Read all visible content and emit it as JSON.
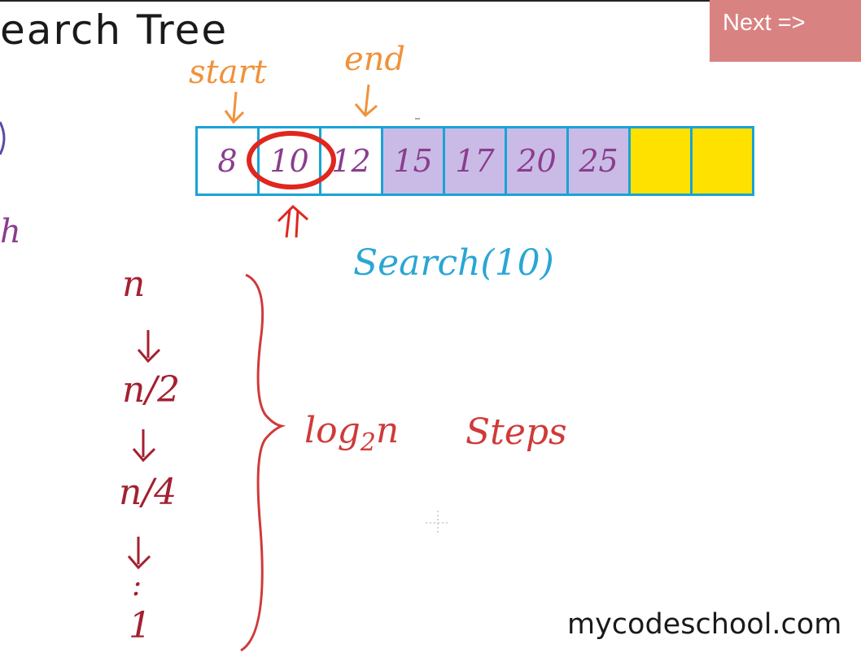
{
  "slide": {
    "title": "earch Tree",
    "start_label": "start",
    "end_label": "end",
    "partial_left_text": "h",
    "search_call": "Search(10)",
    "steps_sequence": [
      "n",
      "n/2",
      "n/4",
      ":",
      "1"
    ],
    "complexity_prefix": "log",
    "complexity_subscript": "2",
    "complexity_var": "n",
    "complexity_suffix": "Steps",
    "array_cells": [
      {
        "value": "8",
        "fill": "#ffffff"
      },
      {
        "value": "10",
        "fill": "#ffffff"
      },
      {
        "value": "12",
        "fill": "#ffffff"
      },
      {
        "value": "15",
        "fill": "#c9bbe6"
      },
      {
        "value": "17",
        "fill": "#c9bbe6"
      },
      {
        "value": "20",
        "fill": "#c9bbe6"
      },
      {
        "value": "25",
        "fill": "#c9bbe6"
      },
      {
        "value": "",
        "fill": "#ffe100"
      },
      {
        "value": "",
        "fill": "#ffe100"
      }
    ]
  },
  "controls": {
    "next_label": "Next =>"
  },
  "watermark": "mycodeschool.com",
  "colors": {
    "pointer_label": "#f0923a",
    "array_border": "#1aa3d6",
    "search_text": "#2aa6d4",
    "steps_text": "#a42030",
    "highlight": "#e0261e",
    "next_bg": "#d98282"
  },
  "icons": [
    "down-arrow-icon",
    "up-double-arrow-icon",
    "curly-brace-icon",
    "cursor-crosshair-icon"
  ]
}
